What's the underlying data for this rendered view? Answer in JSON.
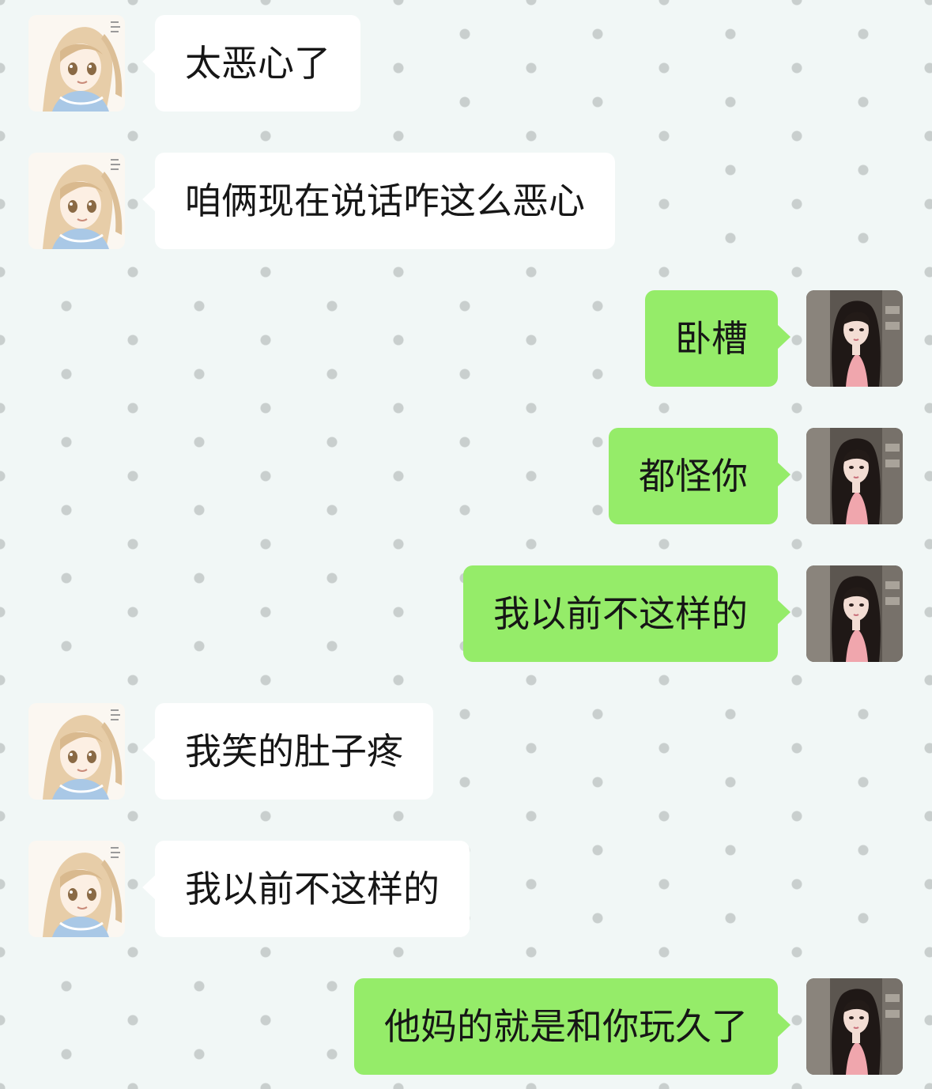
{
  "colors": {
    "background": "#f1f7f6",
    "dot": "#c9cfce",
    "incoming_bubble": "#ffffff",
    "outgoing_bubble": "#95ec69",
    "text": "#161616"
  },
  "messages": [
    {
      "side": "left",
      "text": "太恶心了",
      "avatar": "anime-girl-avatar"
    },
    {
      "side": "left",
      "text": "咱俩现在说话咋这么恶心",
      "avatar": "anime-girl-avatar"
    },
    {
      "side": "right",
      "text": "卧槽",
      "avatar": "long-hair-girl-avatar"
    },
    {
      "side": "right",
      "text": "都怪你",
      "avatar": "long-hair-girl-avatar"
    },
    {
      "side": "right",
      "text": "我以前不这样的",
      "avatar": "long-hair-girl-avatar"
    },
    {
      "side": "left",
      "text": "我笑的肚子疼",
      "avatar": "anime-girl-avatar"
    },
    {
      "side": "left",
      "text": "我以前不这样的",
      "avatar": "anime-girl-avatar"
    },
    {
      "side": "right",
      "text": "他妈的就是和你玩久了",
      "avatar": "long-hair-girl-avatar"
    }
  ]
}
